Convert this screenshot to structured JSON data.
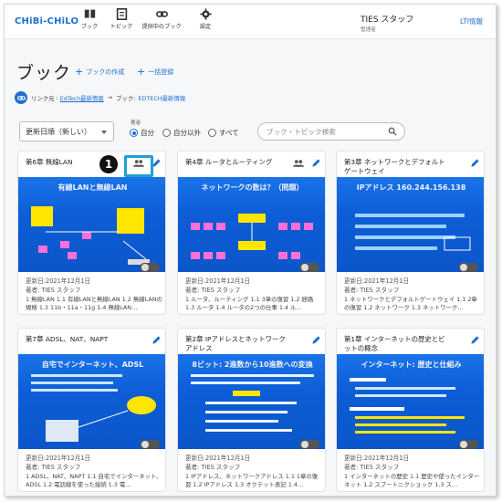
{
  "header": {
    "logo": "CHiBi-CHiLO",
    "nav": [
      {
        "label": "ブック",
        "icon": "book-icon"
      },
      {
        "label": "トピック",
        "icon": "topic-icon"
      },
      {
        "label": "提供中のブック",
        "icon": "link-icon"
      },
      {
        "label": "設定",
        "icon": "gear-icon"
      }
    ],
    "user_name": "TIES スタッフ",
    "user_role": "管理者",
    "login_link": "LTI情報"
  },
  "page": {
    "title": "ブック",
    "create_book": "ブックの作成",
    "bulk_register": "一括登録",
    "link_label": "リンク元",
    "link_source": "EdTech最新情報",
    "link_arrow": "→",
    "book_label": "ブック:",
    "book_target": "EDTECH最新情報"
  },
  "filters": {
    "sort_value": "更新日順（新しい）",
    "owner_label": "著者",
    "radio": [
      "自分",
      "自分以外",
      "すべて"
    ],
    "search_placeholder": "ブック・トピック検索"
  },
  "callout_number": "1",
  "cards": [
    {
      "title": "第6章 無線LAN",
      "thumb_text": "有線LANと無線LAN",
      "updated": "更新日:2021年12月1日",
      "author": "著者: TIES スタッフ",
      "desc": "1 無線LAN 1.1 有線LANと無線LAN 1.2 無線LANの規格 1.3 11b・11a・11g 1.4 無線LAN…"
    },
    {
      "title": "第4章 ルータとルーティング",
      "thumb_text": "ネットワークの数は？（問題）",
      "updated": "更新日:2021年12月1日",
      "author": "著者: TIES スタッフ",
      "desc": "1 ルータ、ルーティング 1.1 3章の復習 1.2 経路 1.3 ルータ 1.4 ルータの2つの仕事 1.4 ル…"
    },
    {
      "title": "第3章 ネットワークとデフォルトゲートウェイ",
      "thumb_text": "IPアドレス 160.244.156.138",
      "updated": "更新日:2021年12月1日",
      "author": "著者: TIES スタッフ",
      "desc": "1 ネットワークとデフォルトゲートウェイ 1.1 2章の復習 1.2 ネットワーク 1.3 ネットワーク…"
    },
    {
      "title": "第7章 ADSL、NAT、NAPT",
      "thumb_text": "自宅でインターネット、ADSL",
      "updated": "更新日:2021年12月1日",
      "author": "著者: TIES スタッフ",
      "desc": "1 ADSL、NAT、NAPT 1.1 自宅でインターネット、ADSL 1.2 電話線を使った接続 1.3 電…"
    },
    {
      "title": "第2章 IPアドレスとネットワークアドレス",
      "thumb_text": "8ビット: 2進数から10進数への変換",
      "updated": "更新日:2021年12月1日",
      "author": "著者: TIES スタッフ",
      "desc": "1 IPアドレス、ネットワークアドレス 1.1 1章の復習 1.2 IPアドレス 1.3 オクテット表記 1.4…"
    },
    {
      "title": "第1章 インターネットの歴史とビットの概念",
      "thumb_text": "インターネット: 歴史と仕組み",
      "updated": "更新日:2021年12月1日",
      "author": "著者: TIES スタッフ",
      "desc": "1 インターネットの歴史 1.1 歴史や使ったインターネット 1.2 スプートニクショック 1.3 ス…"
    }
  ],
  "colors": {
    "accent": "#1f6fd0",
    "thumb": "#1a73e8",
    "callout": "#1e9fd8"
  }
}
